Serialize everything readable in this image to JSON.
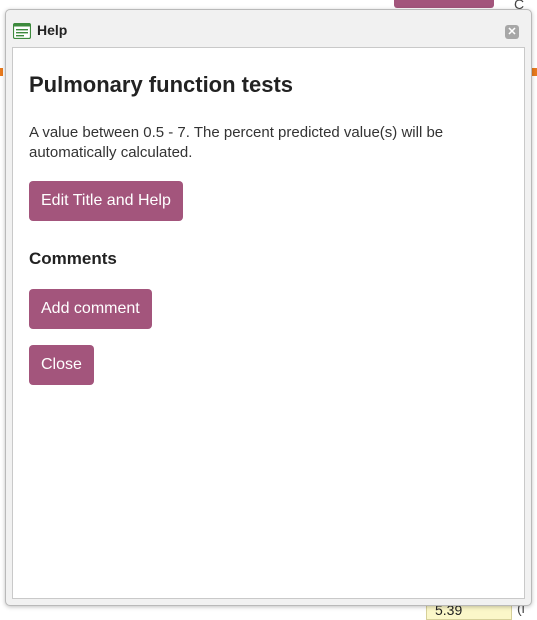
{
  "dialog": {
    "title": "Help",
    "title_icon": "document-icon",
    "close_icon": "close-icon",
    "close_glyph": "✕"
  },
  "content": {
    "heading": "Pulmonary function tests",
    "description": "A value between 0.5 - 7. The percent predicted value(s) will be automatically calculated.",
    "edit_button": "Edit Title and Help",
    "comments_heading": "Comments",
    "add_comment_button": "Add comment",
    "close_button": "Close"
  },
  "background": {
    "field_value": "5.39",
    "top_right_text": "C",
    "bottom_right_text": "(l"
  },
  "colors": {
    "button": "#a3557c",
    "dialog_frame": "#f1f1f1",
    "field_bg": "#fbf7c9",
    "accent_orange": "#e87a1e"
  }
}
